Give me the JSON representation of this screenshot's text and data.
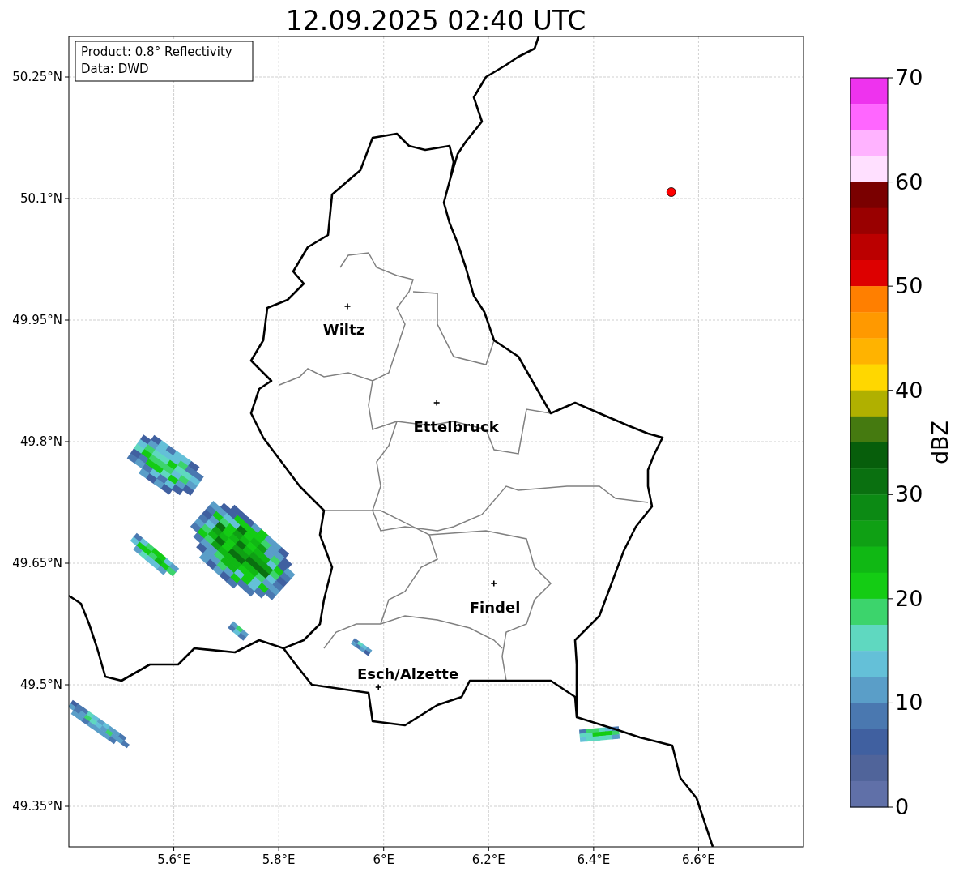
{
  "title": "12.09.2025 02:40 UTC",
  "info_box": [
    "Product: 0.8° Reflectivity",
    "Data: DWD"
  ],
  "map": {
    "lat_labels": [
      "50.25°N",
      "50.1°N",
      "49.95°N",
      "49.8°N",
      "49.65°N",
      "49.5°N",
      "49.35°N"
    ],
    "lon_labels": [
      "5.6°E",
      "5.8°E",
      "6°E",
      "6.2°E",
      "6.4°E",
      "6.6°E"
    ],
    "cities": [
      {
        "name": "Wiltz"
      },
      {
        "name": "Ettelbruck"
      },
      {
        "name": "Findel"
      },
      {
        "name": "Esch/Alzette"
      }
    ]
  },
  "colorbar": {
    "label": "dBZ",
    "ticks": [
      "70",
      "60",
      "50",
      "40",
      "30",
      "20",
      "10",
      "0"
    ],
    "segments": [
      {
        "color": "#ee33ee"
      },
      {
        "color": "#ff66ff"
      },
      {
        "color": "#ffb3ff"
      },
      {
        "color": "#ffe0ff"
      },
      {
        "color": "#7a0000"
      },
      {
        "color": "#990000"
      },
      {
        "color": "#bb0000"
      },
      {
        "color": "#dd0000"
      },
      {
        "color": "#ff7f00"
      },
      {
        "color": "#ff9900"
      },
      {
        "color": "#ffb300"
      },
      {
        "color": "#ffd700"
      },
      {
        "color": "#b0b000"
      },
      {
        "color": "#457a10"
      },
      {
        "color": "#075e0b"
      },
      {
        "color": "#0a7010"
      },
      {
        "color": "#0c8a14"
      },
      {
        "color": "#0fa014"
      },
      {
        "color": "#10b814"
      },
      {
        "color": "#14cc14"
      },
      {
        "color": "#3cd46c"
      },
      {
        "color": "#5fd8c0"
      },
      {
        "color": "#64c0d8"
      },
      {
        "color": "#5a9ec8"
      },
      {
        "color": "#4a78b0"
      },
      {
        "color": "#4060a0"
      },
      {
        "color": "#50649a"
      },
      {
        "color": "#6070a8"
      }
    ]
  }
}
